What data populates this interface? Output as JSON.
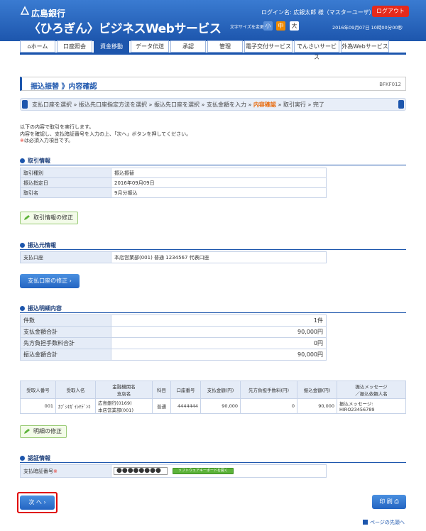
{
  "header": {
    "bank_name": "広島銀行",
    "service_name": "〈ひろぎん〉ビジネスWebサービス",
    "login_info": "ログイン名: 広銀太郎 様（マスターユーザ）",
    "logout_label": "ログアウト",
    "font_size_label": "文字サイズを変更",
    "font_small": "小",
    "font_medium": "中",
    "font_large": "大",
    "datetime": "2016年09月07日 10時00分00秒"
  },
  "nav": {
    "items": [
      {
        "label": "ホーム"
      },
      {
        "label": "口座照会"
      },
      {
        "label": "資金移動"
      },
      {
        "label": "データ伝送"
      },
      {
        "label": "承認"
      },
      {
        "label": "管理"
      },
      {
        "label": "電子交付サービス"
      },
      {
        "label": "でんさいサービス"
      },
      {
        "label": "外為Webサービス"
      }
    ],
    "active_index": 2
  },
  "page": {
    "title": "振込振替 》内容確認",
    "screen_id": "BFKF012"
  },
  "steps": {
    "before": "支払口座を選択 » 振込先口座指定方法を選択 » 振込先口座を選択 » 支払金額を入力 » ",
    "current": "内容確認",
    "after": " » 取引実行 » 完了"
  },
  "intro": {
    "line1": "以下の内容で取引を実行します。",
    "line2": "内容を確認し、支払暗証番号を入力の上、「次へ」ボタンを押してください。",
    "req_mark": "※",
    "line3": "は必須入力項目です。"
  },
  "transaction": {
    "heading": "取引情報",
    "rows": [
      {
        "label": "取引種別",
        "value": "振込振替"
      },
      {
        "label": "振込指定日",
        "value": "2016年09月09日"
      },
      {
        "label": "取引名",
        "value": "9月分振込"
      }
    ],
    "edit_label": "取引情報の修正"
  },
  "source": {
    "heading": "振込元情報",
    "label": "支払口座",
    "value": "本店営業部(001) 普通 1234567 代表口座",
    "edit_label": "支払口座の修正"
  },
  "details": {
    "heading": "振込明細内容",
    "summary": [
      {
        "label": "件数",
        "value": "1件"
      },
      {
        "label": "支払金額合計",
        "value": "90,000円"
      },
      {
        "label": "先方負担手数料合計",
        "value": "0円"
      },
      {
        "label": "振込金額合計",
        "value": "90,000円"
      }
    ],
    "columns": [
      "受取人番号",
      "受取人名",
      "金融機関名\n支店名",
      "科目",
      "口座番号",
      "支払金額(円)",
      "先方負担手数料(円)",
      "振込金額(円)",
      "振込メッセージ\n／振込依頼人名"
    ],
    "rows": [
      {
        "no": "001",
        "name": "ｶﾌﾞｼｷｶﾞｲｼﾔﾃﾞﾝｷ",
        "bank": "広島銀行(0169)",
        "branch": "本店営業部(001)",
        "type": "普通",
        "account": "4444444",
        "amount": "90,000",
        "fee": "0",
        "transfer": "90,000",
        "message": "振込メッセージ:",
        "requester": "HIRO23456789"
      }
    ],
    "edit_label": "明細の修正"
  },
  "auth": {
    "heading": "認証情報",
    "label": "支払暗証番号",
    "req_mark": "※",
    "password_value": "●●●●●●●●",
    "soft_keyboard_label": "ソフトウェアキーボードを開く"
  },
  "buttons": {
    "next_label": "次 へ",
    "print_label": "印 刷"
  },
  "footer": {
    "pagetop_label": "ページの先頭へ"
  },
  "colors": {
    "brand_blue": "#1d56ad",
    "logout_red": "#e52a1c",
    "current_step_orange": "#e86a0c",
    "highlight_red": "#e00000"
  }
}
